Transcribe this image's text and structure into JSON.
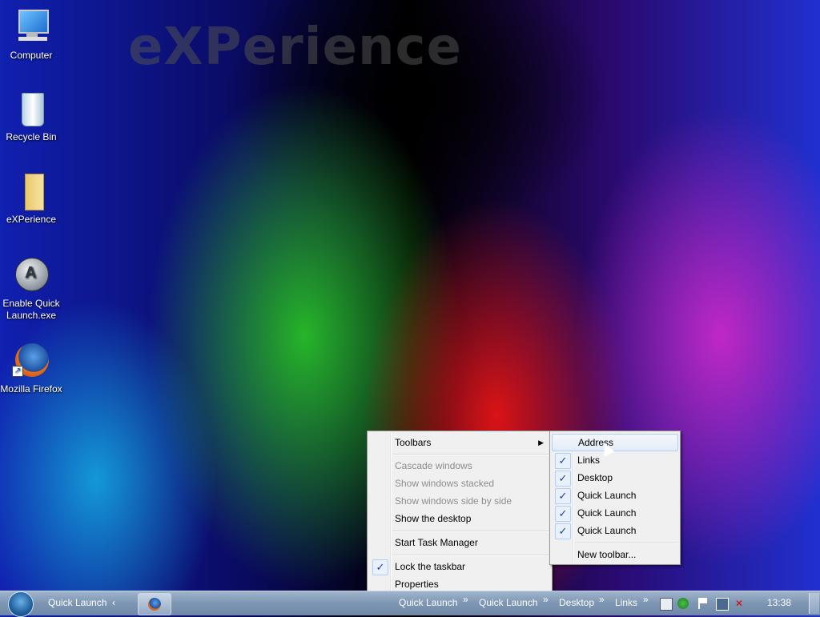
{
  "wallpaper": {
    "watermark": "eXPerience"
  },
  "desktop": {
    "icons": [
      {
        "label": "Computer",
        "icon": "computer-icon"
      },
      {
        "label": "Recycle Bin",
        "icon": "recycle-bin-icon"
      },
      {
        "label": "eXPerience",
        "icon": "folder-icon"
      },
      {
        "label": "Enable Quick Launch.exe",
        "icon": "app-icon"
      },
      {
        "label": "Mozilla Firefox",
        "icon": "firefox-icon"
      }
    ]
  },
  "taskbar": {
    "quick_launch_left": "Quick Launch",
    "toolbars": [
      "Quick Launch",
      "Quick Launch",
      "Desktop",
      "Links"
    ],
    "clock": "13:38",
    "tray_icons": [
      "action-center-icon",
      "security-icon",
      "flag-icon",
      "network-icon",
      "volume-muted-icon"
    ]
  },
  "context_menu": {
    "items": [
      {
        "label": "Toolbars",
        "submenu": true
      },
      {
        "label": "Cascade windows",
        "disabled": true
      },
      {
        "label": "Show windows stacked",
        "disabled": true
      },
      {
        "label": "Show windows side by side",
        "disabled": true
      },
      {
        "label": "Show the desktop"
      },
      {
        "label": "Start Task Manager"
      },
      {
        "label": "Lock the taskbar",
        "checked": true
      },
      {
        "label": "Properties"
      }
    ]
  },
  "toolbars_submenu": {
    "items": [
      {
        "label": "Address",
        "checked": false,
        "highlighted": true
      },
      {
        "label": "Links",
        "checked": true
      },
      {
        "label": "Desktop",
        "checked": true
      },
      {
        "label": "Quick Launch",
        "checked": true
      },
      {
        "label": "Quick Launch",
        "checked": true
      },
      {
        "label": "Quick Launch",
        "checked": true
      },
      {
        "label": "New toolbar...",
        "checked": false
      }
    ]
  }
}
